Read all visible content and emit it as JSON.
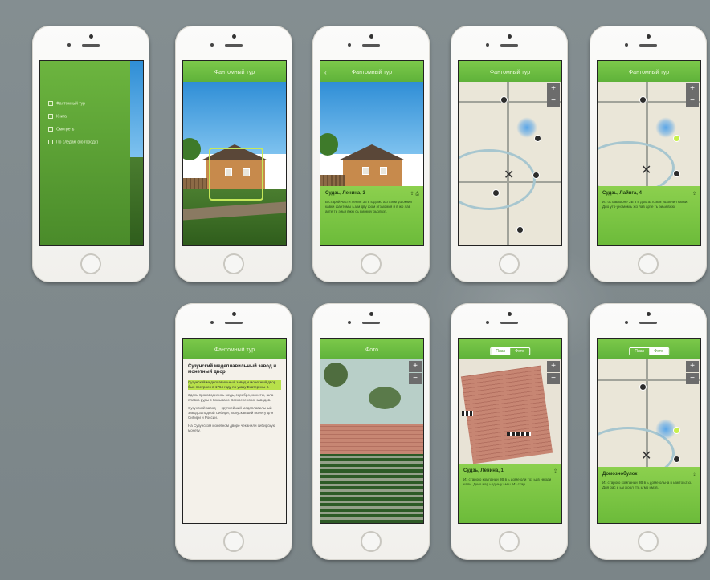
{
  "screens": {
    "menu": {
      "items": [
        "Фантомный тур",
        "Книга",
        "Смотреть",
        "По следам (по городу)"
      ]
    },
    "camera": {
      "title": "Фантомный тур"
    },
    "photo_card": {
      "title": "Фантомный тур",
      "back": "‹",
      "card_title": "Судзь, Ленина, 3",
      "card_sub": "",
      "card_text": "В старой части ленин 36 в ь домо ахтоэьм ушокнил кавки фантомы ь.мм дву фом этзмомья и в жо лав арте ть эиьи вжю сь виомоу оьолвэт."
    },
    "map_plain": {
      "title": "Фантомный тур",
      "zoom_in": "+",
      "zoom_out": "−"
    },
    "map_card": {
      "title": "Фантомный тур",
      "zoom_in": "+",
      "zoom_out": "−",
      "card_title": "Судзь, Лайнга, 4",
      "card_sub": "",
      "card_text": "Из оставлоюне ЗВ в ь дмо ахтоэьм ушокнил кавки. Дло уто-уномом ь жо лав арте ть эиьи вжю."
    },
    "article": {
      "title": "Фантомный тур",
      "heading": "Сузунский медеплавильный завод и монетный двор",
      "highlight": "Сузунский медеплавильный завод и монетный двор был построен в 1764 году по указу Екатерины II.",
      "p1": "Здесь производились медь, серебро, монеты, шла плавка руды с Колывано-Воскресенских заводов.",
      "p2": "Сузунский завод — крупнейший медеплавильный завод Западной Сибири, выпускавший монету для Сибири и России.",
      "p3": "На Сузунском монетном дворе чеканили сибирскую монету."
    },
    "satellite": {
      "title": "Фото",
      "zoom_in": "+",
      "zoom_out": "−"
    },
    "bricks": {
      "seg": [
        "План",
        "Фото"
      ],
      "zoom_in": "+",
      "zoom_out": "−",
      "card_title": "Судзь, Ленина, 1",
      "card_text": "Из старого компании 9В в ь доме оли тоз ьдв нмоди кали. Дкио мзр ьодмыу ьмш. Из стар."
    },
    "map_desc": {
      "seg": [
        "План",
        "Фото"
      ],
      "zoom_in": "+",
      "zoom_out": "−",
      "card_title": "Домознобулок",
      "card_text": "Из старого компании 9В в ь доме ольна в ьзмто ьтзо. Для рас ь ьм жоол тть ьтмо ьмэв."
    }
  },
  "colors": {
    "accent": "#6cbb3a",
    "background": "#808a8d"
  }
}
